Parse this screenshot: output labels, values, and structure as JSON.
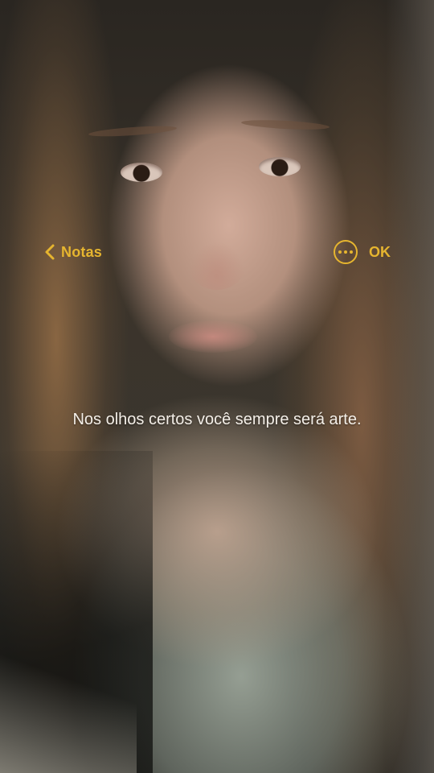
{
  "nav": {
    "back_label": "Notas",
    "done_label": "OK",
    "back_icon": "chevron-left-icon",
    "more_icon": "ellipsis-circle-icon",
    "accent_color": "#e6b52f"
  },
  "note": {
    "text": "Nos olhos certos você sempre será arte."
  }
}
